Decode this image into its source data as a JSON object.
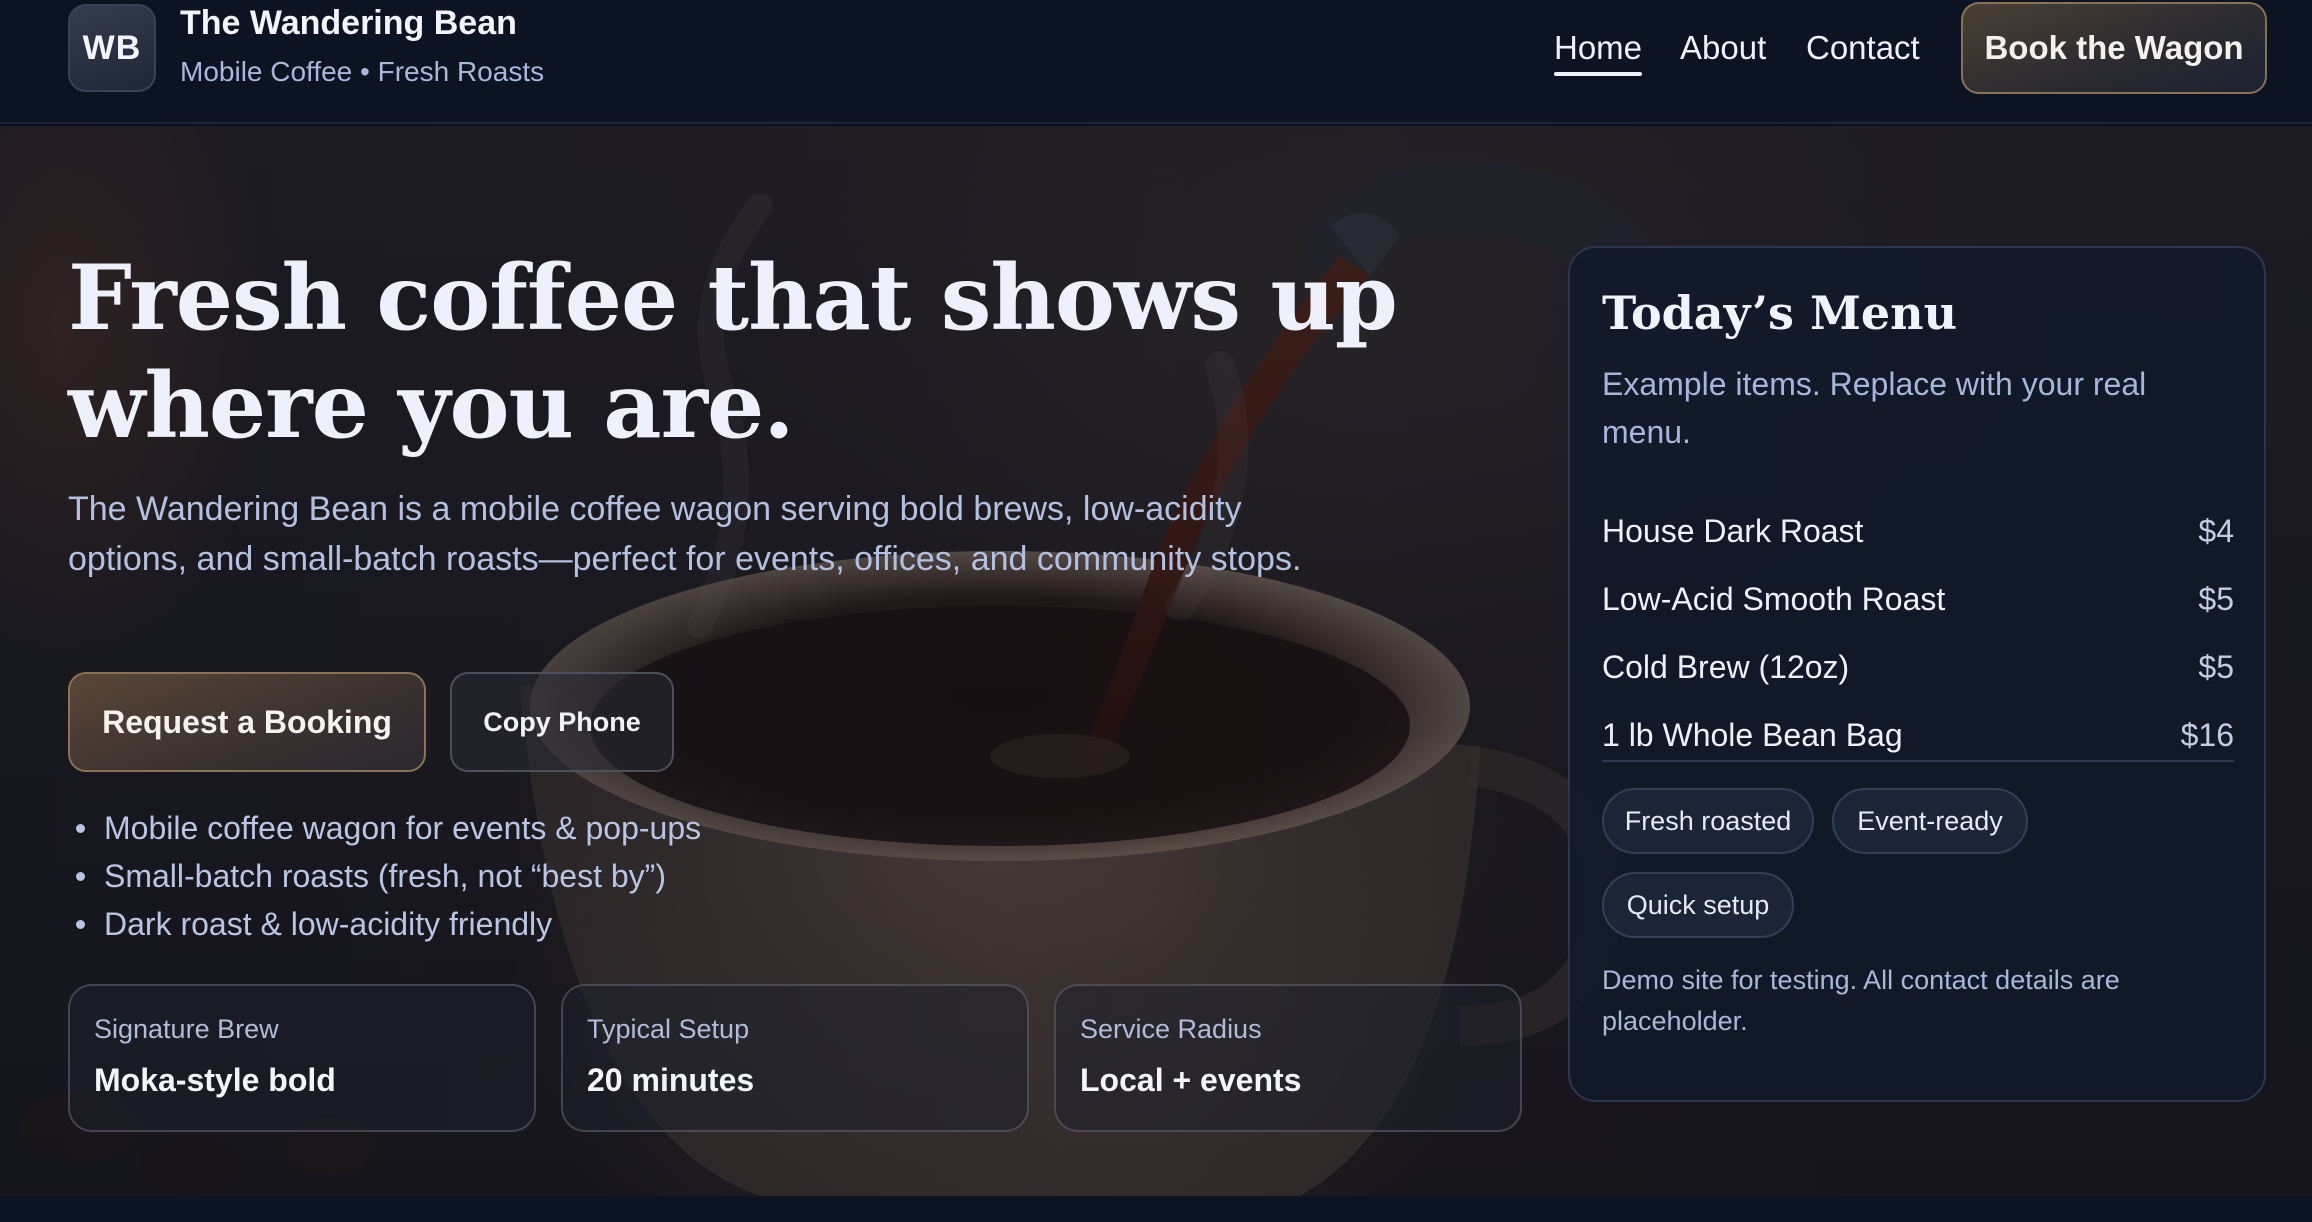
{
  "header": {
    "logo_initials": "WB",
    "brand_name": "The Wandering Bean",
    "tagline": "Mobile Coffee • Fresh Roasts",
    "nav": [
      {
        "label": "Home",
        "active": true
      },
      {
        "label": "About",
        "active": false
      },
      {
        "label": "Contact",
        "active": false
      }
    ],
    "cta_label": "Book the Wagon"
  },
  "hero": {
    "title_line1": "Fresh coffee that shows up",
    "title_line2": "where you are.",
    "description": "The Wandering Bean is a mobile coffee wagon serving bold brews, low-acidity options, and small-batch roasts—perfect for events, offices, and community stops.",
    "primary_button": "Request a Booking",
    "secondary_button": "Copy Phone",
    "features": [
      "Mobile coffee wagon for events & pop-ups",
      "Small-batch roasts (fresh, not “best by”)",
      "Dark roast & low-acidity friendly"
    ],
    "stats": [
      {
        "label": "Signature Brew",
        "value": "Moka-style bold"
      },
      {
        "label": "Typical Setup",
        "value": "20 minutes"
      },
      {
        "label": "Service Radius",
        "value": "Local + events"
      }
    ]
  },
  "menu": {
    "title": "Today’s Menu",
    "subtitle": "Example items. Replace with your real menu.",
    "items": [
      {
        "name": "House Dark Roast",
        "price": "$4"
      },
      {
        "name": "Low-Acid Smooth Roast",
        "price": "$5"
      },
      {
        "name": "Cold Brew (12oz)",
        "price": "$5"
      },
      {
        "name": "1 lb Whole Bean Bag",
        "price": "$16"
      }
    ],
    "tags": [
      "Fresh roasted",
      "Event-ready",
      "Quick setup"
    ],
    "note": "Demo site for testing. All contact details are placeholder."
  },
  "colors": {
    "page_bg": "#0b1120",
    "accent_border": "#8c7254",
    "muted_text": "#a9b8da"
  }
}
